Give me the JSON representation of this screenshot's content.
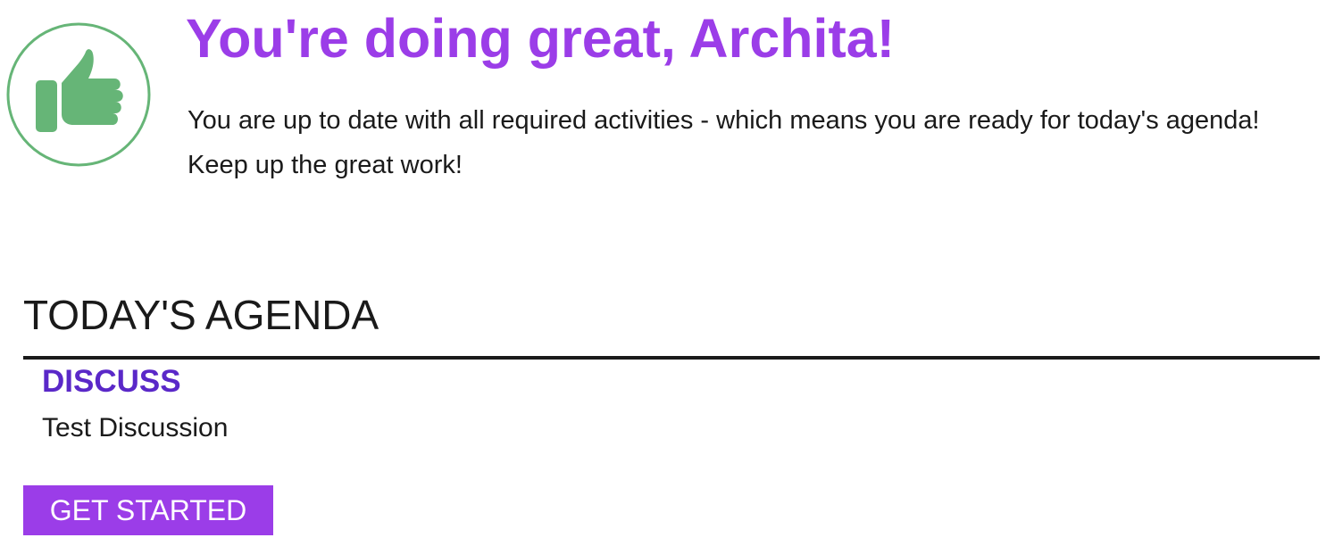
{
  "hero": {
    "icon": "thumbs-up-icon",
    "headline": "You're doing great, Archita!",
    "message": "You are up to date with all required activities - which means you are ready for today's agenda! Keep up the great work!"
  },
  "agenda": {
    "title": "TODAY'S AGENDA",
    "items": [
      {
        "section": "DISCUSS",
        "activity": "Test Discussion"
      }
    ],
    "cta_label": "GET STARTED"
  },
  "colors": {
    "headline": "#9b3de8",
    "section_label": "#5a28c8",
    "button": "#9b3de8",
    "icon_green": "#66b577",
    "rule": "#1a1a1a"
  }
}
